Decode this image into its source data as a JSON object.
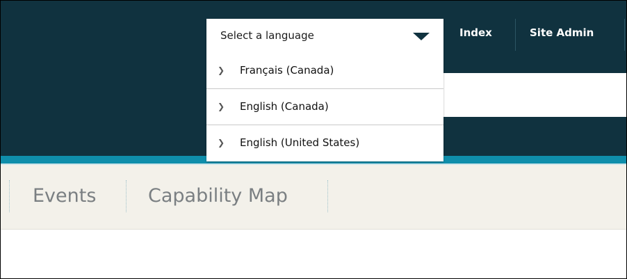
{
  "top_nav": {
    "items": [
      {
        "label": "Index"
      },
      {
        "label": "Site Admin"
      }
    ]
  },
  "language_select": {
    "placeholder": "Select a language",
    "options": [
      {
        "label": "Français (Canada)"
      },
      {
        "label": "English (Canada)"
      },
      {
        "label": "English (United States)"
      }
    ]
  },
  "sub_nav": {
    "items": [
      {
        "label": "Events"
      },
      {
        "label": "Capability Map"
      }
    ]
  },
  "icons": {
    "dropdown_caret": "caret-down-icon",
    "option_bullet": "chevron-right-icon"
  },
  "colors": {
    "header_bg": "#10323f",
    "accent_teal": "#0f8eab",
    "subnav_bg": "#f3f1ea",
    "subnav_text": "#7a7f82"
  }
}
